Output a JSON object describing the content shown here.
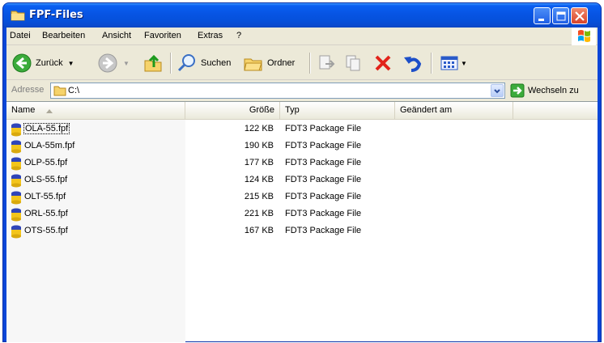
{
  "window": {
    "title": "FPF-Files"
  },
  "menu": [
    "Datei",
    "Bearbeiten",
    "Ansicht",
    "Favoriten",
    "Extras",
    "?"
  ],
  "toolbar": {
    "back_label": "Zurück",
    "search_label": "Suchen",
    "folders_label": "Ordner"
  },
  "address": {
    "label": "Adresse",
    "value": "C:\\",
    "go_label": "Wechseln zu"
  },
  "columns": [
    "Name",
    "Größe",
    "Typ",
    "Geändert am"
  ],
  "files": [
    {
      "name": "OLA-55.fpf",
      "size": "122 KB",
      "type": "FDT3 Package File"
    },
    {
      "name": "OLA-55m.fpf",
      "size": "190 KB",
      "type": "FDT3 Package File"
    },
    {
      "name": "OLP-55.fpf",
      "size": "177 KB",
      "type": "FDT3 Package File"
    },
    {
      "name": "OLS-55.fpf",
      "size": "124 KB",
      "type": "FDT3 Package File"
    },
    {
      "name": "OLT-55.fpf",
      "size": "215 KB",
      "type": "FDT3 Package File"
    },
    {
      "name": "ORL-55.fpf",
      "size": "221 KB",
      "type": "FDT3 Package File"
    },
    {
      "name": "OTS-55.fpf",
      "size": "167 KB",
      "type": "FDT3 Package File"
    }
  ],
  "colors": {
    "titlebar": "#0754e3",
    "chrome": "#ece9d8",
    "close_button": "#d9432a"
  }
}
